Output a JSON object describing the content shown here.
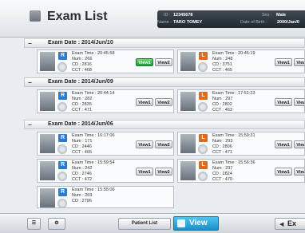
{
  "header": {
    "title": "Exam List",
    "id_label": "ID :",
    "id_value": "12345678",
    "name_label": "Name :",
    "name_value": "TARO TOMEY",
    "sex_label": "Sex :",
    "sex_value": "Male",
    "dob_label": "Date of Birth :",
    "dob_value": "2000/Jan/0"
  },
  "sections": [
    {
      "date": "Exam Date : 2014/Jun/10",
      "cards": [
        {
          "eye": "R",
          "time": "Exam Time : 20:45:58",
          "num": "Num : 266",
          "cd": "CD : 2816",
          "cct": "CCT : 468",
          "btn1": "View1",
          "btn2": "View2",
          "btn1_active": true
        },
        {
          "eye": "L",
          "time": "Exam Time : 20:45:19",
          "num": "Num : 248",
          "cd": "CD : 3751",
          "cct": "CCT : 465",
          "btn1": "View1",
          "btn2": "View2"
        }
      ]
    },
    {
      "date": "Exam Date : 2014/Jun/09",
      "cards": [
        {
          "eye": "R",
          "time": "Exam Time : 20:44:14",
          "num": "Num : 282",
          "cd": "CD : 2835",
          "cct": "CCT : 471",
          "btn1": "View1",
          "btn2": "View2"
        },
        {
          "eye": "L",
          "time": "Exam Time : 17:51:23",
          "num": "Num : 297",
          "cd": "CD : 2802",
          "cct": "CCT : 463",
          "btn1": "View1",
          "btn2": "View2"
        }
      ]
    },
    {
      "date": "Exam Date : 2014/Jun/06",
      "cards": [
        {
          "eye": "R",
          "time": "Exam Time : 16:17:06",
          "num": "Num : 171",
          "cd": "CD : 2446",
          "cct": "CCT : 465",
          "btn1": "View1",
          "btn2": "View2"
        },
        {
          "eye": "L",
          "time": "Exam Time : 15:59:31",
          "num": "Num : 293",
          "cd": "CD : 2806",
          "cct": "CCT : 471",
          "btn1": "View1",
          "btn2": "View2"
        },
        {
          "eye": "R",
          "time": "Exam Time : 15:59:54",
          "num": "Num : 242",
          "cd": "CD : 2746",
          "cct": "CCT : 472",
          "btn1": "View1",
          "btn2": "View2"
        },
        {
          "eye": "L",
          "time": "Exam Time : 15:56:36",
          "num": "Num : 237",
          "cd": "CD : 2824",
          "cct": "CCT : 470",
          "btn1": "View1",
          "btn2": "View2"
        },
        {
          "eye": "R",
          "time": "Exam Time : 15:55:06",
          "num": "Num : 269",
          "cd": "CD : 2796",
          "cct": "",
          "btn1": "",
          "btn2": ""
        }
      ]
    }
  ],
  "footer": {
    "patient_list": "Patient List",
    "view": "View",
    "export": "Ex"
  },
  "icons": {
    "app": "list-icon",
    "view": "view-icon",
    "export": "export-icon",
    "footer_left_1": "grid-icon",
    "footer_left_2": "settings-icon"
  },
  "colors": {
    "right_eye": "#2a7bd0",
    "left_eye": "#e06a1c",
    "view_active": "#1e9b3a",
    "view_button": "#1b8fc9"
  }
}
